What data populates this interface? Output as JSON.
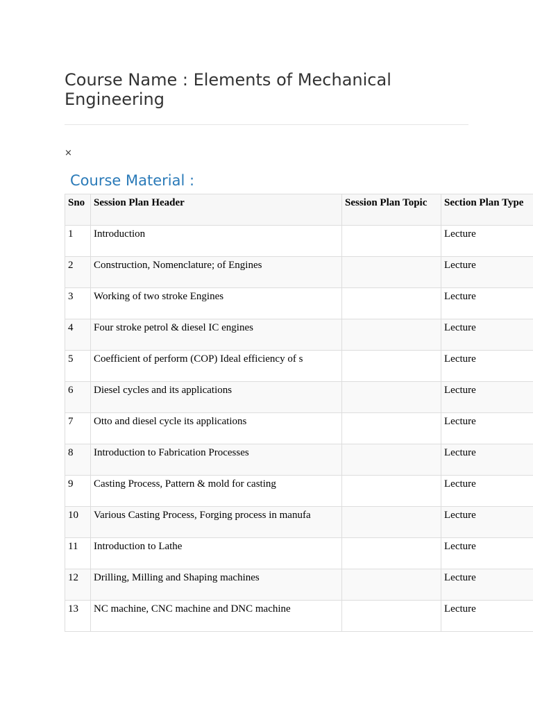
{
  "course": {
    "title": "Course Name : Elements of Mechanical Engineering"
  },
  "close_glyph": "×",
  "material": {
    "heading": "Course Material :",
    "columns": [
      "Sno",
      "Session Plan Header",
      "Session Plan Topic",
      "Section Plan Type"
    ],
    "rows": [
      {
        "sno": "1",
        "header": "Introduction",
        "topic": "",
        "type": "Lecture"
      },
      {
        "sno": "2",
        "header": "Construction, Nomenclature; of Engines",
        "topic": "",
        "type": "Lecture"
      },
      {
        "sno": "3",
        "header": "Working of two stroke Engines",
        "topic": "",
        "type": "Lecture"
      },
      {
        "sno": "4",
        "header": "Four stroke petrol & diesel IC engines",
        "topic": "",
        "type": "Lecture"
      },
      {
        "sno": "5",
        "header": "Coefficient of perform (COP) Ideal efficiency of s",
        "topic": "",
        "type": "Lecture"
      },
      {
        "sno": "6",
        "header": "Diesel cycles and its applications",
        "topic": "",
        "type": "Lecture"
      },
      {
        "sno": "7",
        "header": "Otto and diesel cycle its applications",
        "topic": "",
        "type": "Lecture"
      },
      {
        "sno": "8",
        "header": "Introduction to Fabrication Processes",
        "topic": "",
        "type": "Lecture"
      },
      {
        "sno": "9",
        "header": "Casting Process, Pattern & mold for casting",
        "topic": "",
        "type": "Lecture"
      },
      {
        "sno": "10",
        "header": "Various Casting Process, Forging process in manufa",
        "topic": "",
        "type": "Lecture"
      },
      {
        "sno": "11",
        "header": "Introduction to Lathe",
        "topic": "",
        "type": "Lecture"
      },
      {
        "sno": "12",
        "header": "Drilling, Milling and Shaping machines",
        "topic": "",
        "type": "Lecture"
      },
      {
        "sno": "13",
        "header": "NC machine, CNC machine and DNC machine",
        "topic": "",
        "type": "Lecture"
      }
    ]
  }
}
